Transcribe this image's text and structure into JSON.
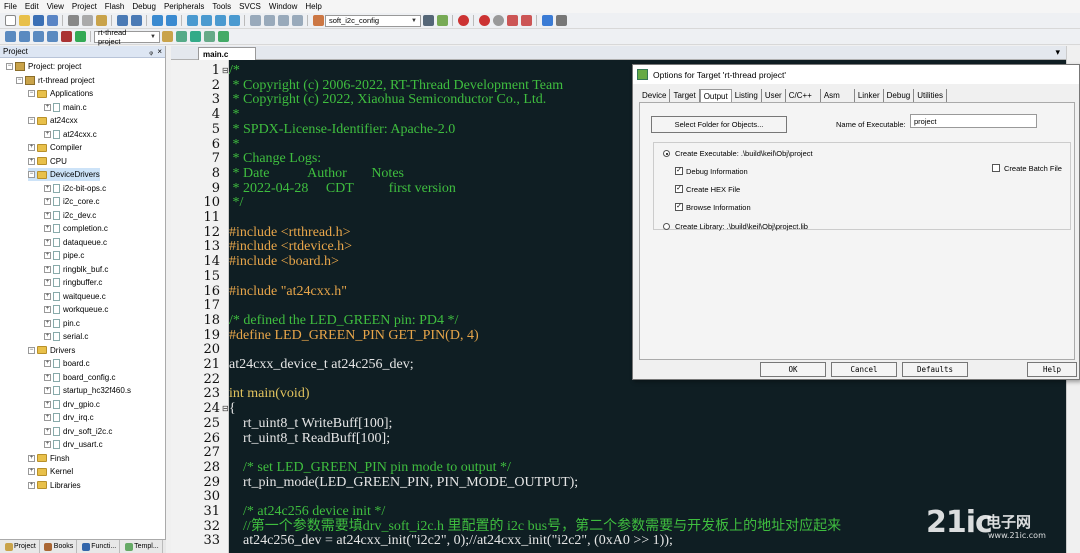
{
  "menu": [
    "File",
    "Edit",
    "View",
    "Project",
    "Flash",
    "Debug",
    "Peripherals",
    "Tools",
    "SVCS",
    "Window",
    "Help"
  ],
  "toolbar": {
    "target_combo": "soft_i2c_config",
    "project_combo": "rt-thread project"
  },
  "project_panel": {
    "title": "Project",
    "pin": "ᵩ",
    "close": "×",
    "tree": [
      {
        "label": "Project: project",
        "kind": "root",
        "level": 0
      },
      {
        "label": "rt-thread project",
        "kind": "project",
        "level": 1
      },
      {
        "label": "Applications",
        "kind": "folder",
        "level": 2
      },
      {
        "label": "main.c",
        "kind": "file",
        "level": 3
      },
      {
        "label": "at24cxx",
        "kind": "folder",
        "level": 2
      },
      {
        "label": "at24cxx.c",
        "kind": "file",
        "level": 3
      },
      {
        "label": "Compiler",
        "kind": "folder",
        "level": 2
      },
      {
        "label": "CPU",
        "kind": "folder",
        "level": 2
      },
      {
        "label": "DeviceDrivers",
        "kind": "folder",
        "level": 2
      },
      {
        "label": "i2c-bit-ops.c",
        "kind": "file",
        "level": 3
      },
      {
        "label": "i2c_core.c",
        "kind": "file",
        "level": 3
      },
      {
        "label": "i2c_dev.c",
        "kind": "file",
        "level": 3
      },
      {
        "label": "completion.c",
        "kind": "file",
        "level": 3
      },
      {
        "label": "dataqueue.c",
        "kind": "file",
        "level": 3
      },
      {
        "label": "pipe.c",
        "kind": "file",
        "level": 3
      },
      {
        "label": "ringblk_buf.c",
        "kind": "file",
        "level": 3
      },
      {
        "label": "ringbuffer.c",
        "kind": "file",
        "level": 3
      },
      {
        "label": "waitqueue.c",
        "kind": "file",
        "level": 3
      },
      {
        "label": "workqueue.c",
        "kind": "file",
        "level": 3
      },
      {
        "label": "pin.c",
        "kind": "file",
        "level": 3
      },
      {
        "label": "serial.c",
        "kind": "file",
        "level": 3
      },
      {
        "label": "Drivers",
        "kind": "folder",
        "level": 2
      },
      {
        "label": "board.c",
        "kind": "file",
        "level": 3
      },
      {
        "label": "board_config.c",
        "kind": "file",
        "level": 3
      },
      {
        "label": "startup_hc32f460.s",
        "kind": "file",
        "level": 3
      },
      {
        "label": "drv_gpio.c",
        "kind": "file",
        "level": 3
      },
      {
        "label": "drv_irq.c",
        "kind": "file",
        "level": 3
      },
      {
        "label": "drv_soft_i2c.c",
        "kind": "file",
        "level": 3
      },
      {
        "label": "drv_usart.c",
        "kind": "file",
        "level": 3
      },
      {
        "label": "Finsh",
        "kind": "folder",
        "level": 2
      },
      {
        "label": "Kernel",
        "kind": "folder",
        "level": 2
      },
      {
        "label": "Libraries",
        "kind": "folder",
        "level": 2
      }
    ],
    "bottom_tabs": [
      "Project",
      "Books",
      "Functi...",
      "Templ..."
    ]
  },
  "editor": {
    "tab": "main.c",
    "line_numbers": [
      "1",
      "2",
      "3",
      "4",
      "5",
      "6",
      "7",
      "8",
      "9",
      "10",
      "11",
      "12",
      "13",
      "14",
      "15",
      "16",
      "17",
      "18",
      "19",
      "20",
      "21",
      "22",
      "23",
      "24",
      "25",
      "26",
      "27",
      "28",
      "29",
      "30",
      "31",
      "32",
      "33"
    ],
    "lines": [
      "/*",
      " * Copyright (c) 2006-2022, RT-Thread Development Team",
      " * Copyright (c) 2022, Xiaohua Semiconductor Co., Ltd.",
      " *",
      " * SPDX-License-Identifier: Apache-2.0",
      " *",
      " * Change Logs:",
      " * Date           Author       Notes",
      " * 2022-04-28     CDT          first version",
      " */",
      "",
      "#include <rtthread.h>",
      "#include <rtdevice.h>",
      "#include <board.h>",
      "",
      "#include \"at24cxx.h\"",
      "",
      "/* defined the LED_GREEN pin: PD4 */",
      "#define LED_GREEN_PIN GET_PIN(D, 4)",
      "",
      "at24cxx_device_t at24c256_dev;",
      "",
      "int main(void)",
      "{",
      "    rt_uint8_t WriteBuff[100];",
      "    rt_uint8_t ReadBuff[100];",
      "",
      "    /* set LED_GREEN_PIN pin mode to output */",
      "    rt_pin_mode(LED_GREEN_PIN, PIN_MODE_OUTPUT);",
      "",
      "    /* at24c256 device init */",
      "    //第一个参数需要填drv_soft_i2c.h 里配置的 i2c bus号，第二个参数需要与开发板上的地址对应起来",
      "    at24c256_dev = at24cxx_init(\"i2c2\", 0);//at24cxx_init(\"i2c2\", (0xA0 >> 1));"
    ]
  },
  "dialog": {
    "title": "Options for Target 'rt-thread project'",
    "tabs": [
      "Device",
      "Target",
      "Output",
      "Listing",
      "User",
      "C/C++",
      "Asm",
      "Linker",
      "Debug",
      "Utilities"
    ],
    "active_tab": "Output",
    "select_folder_button": "Select Folder for Objects...",
    "name_label": "Name of Executable:",
    "name_value": "project",
    "create_executable": "Create Executable:  .\\build\\keil\\Obj\\project",
    "debug_info": "Debug Information",
    "create_hex": "Create HEX File",
    "browse_info": "Browse Information",
    "create_batch": "Create Batch File",
    "create_library": "Create Library:  .\\build\\keil\\Obj\\project.lib",
    "ok": "OK",
    "cancel": "Cancel",
    "defaults": "Defaults",
    "help": "Help"
  },
  "watermark": {
    "logo": "21ic",
    "cn": "电子网",
    "url": "www.21ic.com"
  }
}
